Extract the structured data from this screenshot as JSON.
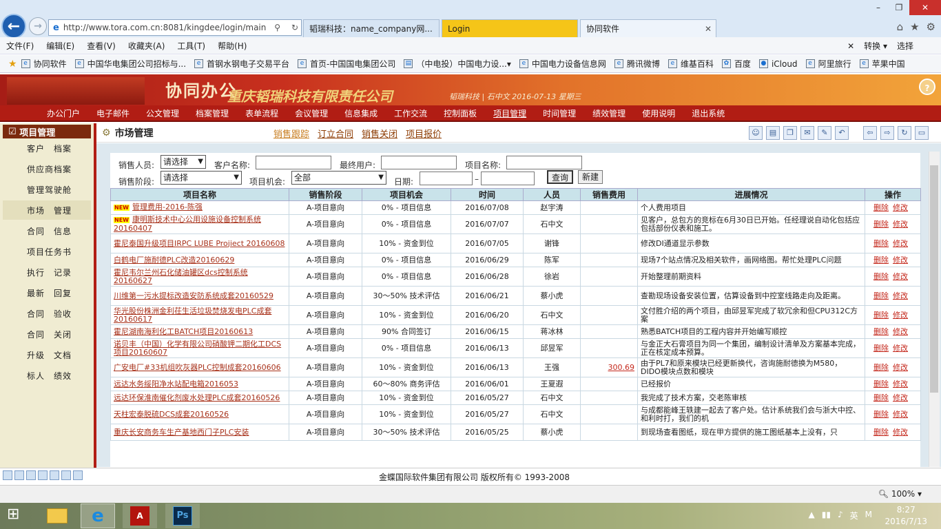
{
  "browser": {
    "url": "http://www.tora.com.cn:8081/kingdee/login/main",
    "tabs": [
      {
        "label": "韬瑞科技：name_company网..."
      },
      {
        "label": "Login"
      },
      {
        "label": "协同软件"
      }
    ],
    "menu": [
      "文件(F)",
      "编辑(E)",
      "查看(V)",
      "收藏夹(A)",
      "工具(T)",
      "帮助(H)"
    ],
    "menu_right": {
      "convert": "转换",
      "select": "选择"
    },
    "favorites": [
      "协同软件",
      "中国华电集团公司招标与...",
      "首钢水钢电子交易平台",
      "首页-中国国电集团公司",
      "（中电投）中国电力设...",
      "中国电力设备信息网",
      "腾讯微博",
      "维基百科",
      "百度",
      "iCloud",
      "阿里旅行",
      "苹果中国"
    ]
  },
  "app": {
    "logo": "协同办公",
    "company": "重庆韬瑞科技有限责任公司",
    "date_line": "韬瑞科技 | 石中文 2016-07-13 星期三",
    "nav": [
      "办公门户",
      "电子邮件",
      "公文管理",
      "档案管理",
      "表单流程",
      "会议管理",
      "信息集成",
      "工作交流",
      "控制面板",
      "项目管理",
      "时间管理",
      "绩效管理",
      "使用说明",
      "退出系统"
    ]
  },
  "sidebar": {
    "title": "项目管理",
    "items": [
      "客户　档案",
      "供应商档案",
      "管理驾驶舱",
      "市场　管理",
      "合同　信息",
      "项目任务书",
      "执行　记录",
      "最新　回复",
      "合同　验收",
      "合同　关闭",
      "升级　文档",
      "标人　绩效"
    ]
  },
  "page": {
    "title": "市场管理",
    "subtabs": [
      "销售跟踪",
      "订立合同",
      "销售关闭",
      "项目报价"
    ]
  },
  "filters": {
    "sales_person_label": "销售人员:",
    "sales_person_value": "请选择",
    "customer_label": "客户名称:",
    "end_user_label": "最终用户:",
    "project_label": "项目名称:",
    "stage_label": "销售阶段:",
    "stage_value": "请选择",
    "chance_label": "项目机会:",
    "chance_value": "全部",
    "date_label": "日期:",
    "date_sep": "–",
    "query": "查询",
    "new": "新建"
  },
  "table": {
    "headers": [
      "项目名称",
      "销售阶段",
      "项目机会",
      "时间",
      "人员",
      "销售费用",
      "进展情况",
      "操作"
    ],
    "delete": "删除",
    "edit": "修改",
    "rows": [
      {
        "new": true,
        "name": "管理费用-2016-陈强",
        "stage": "A-项目意向",
        "chance": "0% - 项目信息",
        "date": "2016/07/08",
        "person": "赵宇涛",
        "fee": "",
        "progress": "个人费用项目"
      },
      {
        "new": true,
        "name": "康明斯技术中心公用设施设备控制系统20160407",
        "stage": "A-项目意向",
        "chance": "0% - 项目信息",
        "date": "2016/07/07",
        "person": "石中文",
        "fee": "",
        "progress": "见客户，总包方的竞标在6月30日已开始。任经理说自动化包括应包括部份仪表和施工。"
      },
      {
        "new": false,
        "name": "霍尼泰国升级项目IRPC LUBE Projiect 20160608",
        "stage": "A-项目意向",
        "chance": "10% - 资金到位",
        "date": "2016/07/05",
        "person": "谢锋",
        "fee": "",
        "progress": "修改DI通道显示参数"
      },
      {
        "new": false,
        "name": "白鹤电厂施耐德PLC改造20160629",
        "stage": "A-项目意向",
        "chance": "0% - 项目信息",
        "date": "2016/06/29",
        "person": "陈军",
        "fee": "",
        "progress": "现场7个站点情况及相关软件，画网络图。帮忙处理PLC问题"
      },
      {
        "new": false,
        "name": "霍尼韦尔兰州石化储油罐区dcs控制系统20160627",
        "stage": "A-项目意向",
        "chance": "0% - 项目信息",
        "date": "2016/06/28",
        "person": "徐岩",
        "fee": "",
        "progress": "开始整理前期资料"
      },
      {
        "new": false,
        "name": "川维第一污水提标改造安防系统成套20160529",
        "stage": "A-项目意向",
        "chance": "30～50% 技术评估",
        "date": "2016/06/21",
        "person": "蔡小虎",
        "fee": "",
        "progress": "查勘现场设备安装位置，估算设备到中控室线路走向及距离。"
      },
      {
        "new": false,
        "name": "华光股份株洲金利茌生活垃圾焚烧发电PLC成套20160617",
        "stage": "A-项目意向",
        "chance": "10% - 资金到位",
        "date": "2016/06/20",
        "person": "石中文",
        "fee": "",
        "progress": "文付胜介绍的两个项目，由邱昱军完成了软冗余和但CPU312C方案"
      },
      {
        "new": false,
        "name": "霍尼湖南海利化工BATCH项目20160613",
        "stage": "A-项目意向",
        "chance": "90% 合同签订",
        "date": "2016/06/15",
        "person": "蒋冰林",
        "fee": "",
        "progress": "熟悉BATCH项目的工程内容并开始编写顺控"
      },
      {
        "new": false,
        "name": "诺贝丰（中国）化学有限公司硝酸钾二期化工DCS项目20160607",
        "stage": "A-项目意向",
        "chance": "0% - 项目信息",
        "date": "2016/06/13",
        "person": "邱昱军",
        "fee": "",
        "progress": "与金正大石膏项目为同一个集团，编制设计清单及方案基本完成，正在核定成本预算。"
      },
      {
        "new": false,
        "name": "广安电厂#33机组吹灰器PLC控制成套20160606",
        "stage": "A-项目意向",
        "chance": "10% - 资金到位",
        "date": "2016/06/13",
        "person": "王强",
        "fee": "300.69",
        "progress": "由于PL7和原来模块已经更新换代，咨询施耐德换为M580，DIDO模块点数和模块"
      },
      {
        "new": false,
        "name": "远达水务绥阳净水站配电箱2016053",
        "stage": "A-项目意向",
        "chance": "60～80% 商务评估",
        "date": "2016/06/01",
        "person": "王夏遐",
        "fee": "",
        "progress": "已经报价"
      },
      {
        "new": false,
        "name": "远达环保淮南催化剂废水处理PLC成套20160526",
        "stage": "A-项目意向",
        "chance": "10% - 资金到位",
        "date": "2016/05/27",
        "person": "石中文",
        "fee": "",
        "progress": "我完成了技术方案，交老陈审核"
      },
      {
        "new": false,
        "name": "天柱宏泰脱硫DCS成套20160526",
        "stage": "A-项目意向",
        "chance": "10% - 资金到位",
        "date": "2016/05/27",
        "person": "石中文",
        "fee": "",
        "progress": "与成都能峰王轶建一起去了客户处。估计系统我们会与浙大中控、和利时打，我们的机"
      },
      {
        "new": false,
        "name": "重庆长安商务车生产基地西门子PLC安装",
        "stage": "A-项目意向",
        "chance": "30～50% 技术评估",
        "date": "2016/05/25",
        "person": "蔡小虎",
        "fee": "",
        "progress": "到现场查看图纸，现在甲方提供的施工图纸基本上没有，只"
      }
    ]
  },
  "footer": {
    "copyright": "金蝶国际软件集团有限公司 版权所有© 1993-2008"
  },
  "status": {
    "zoom": "100%"
  },
  "taskbar": {
    "time": "8:27",
    "date": "2016/7/13",
    "ime": "英"
  }
}
